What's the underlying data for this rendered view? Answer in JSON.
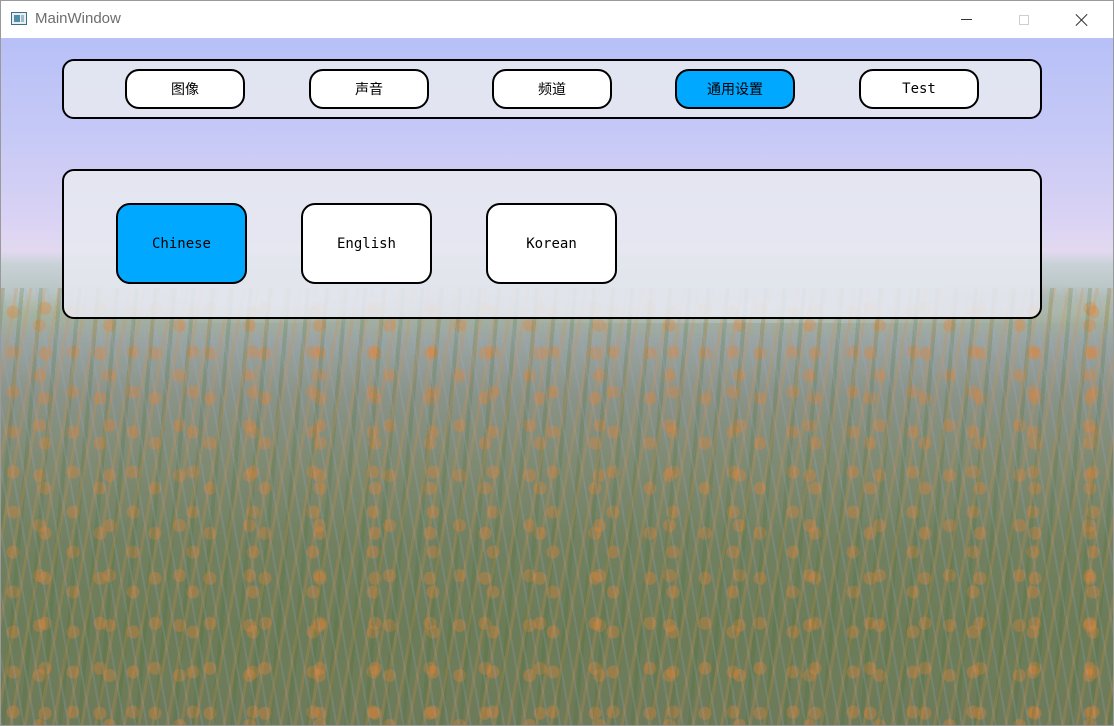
{
  "window": {
    "title": "MainWindow",
    "controls": {
      "minimize": "minimize-icon",
      "maximize": "maximize-icon",
      "close": "close-icon"
    }
  },
  "tabs": [
    {
      "label": "图像",
      "active": false
    },
    {
      "label": "声音",
      "active": false
    },
    {
      "label": "频道",
      "active": false
    },
    {
      "label": "通用设置",
      "active": true
    },
    {
      "label": "Test",
      "active": false
    }
  ],
  "languages": [
    {
      "label": "Chinese",
      "active": true
    },
    {
      "label": "English",
      "active": false
    },
    {
      "label": "Korean",
      "active": false
    }
  ],
  "colors": {
    "active": "#00a8ff",
    "button_bg": "#ffffff",
    "border": "#000000",
    "panel_bg": "rgba(230,232,240,0.88)"
  }
}
